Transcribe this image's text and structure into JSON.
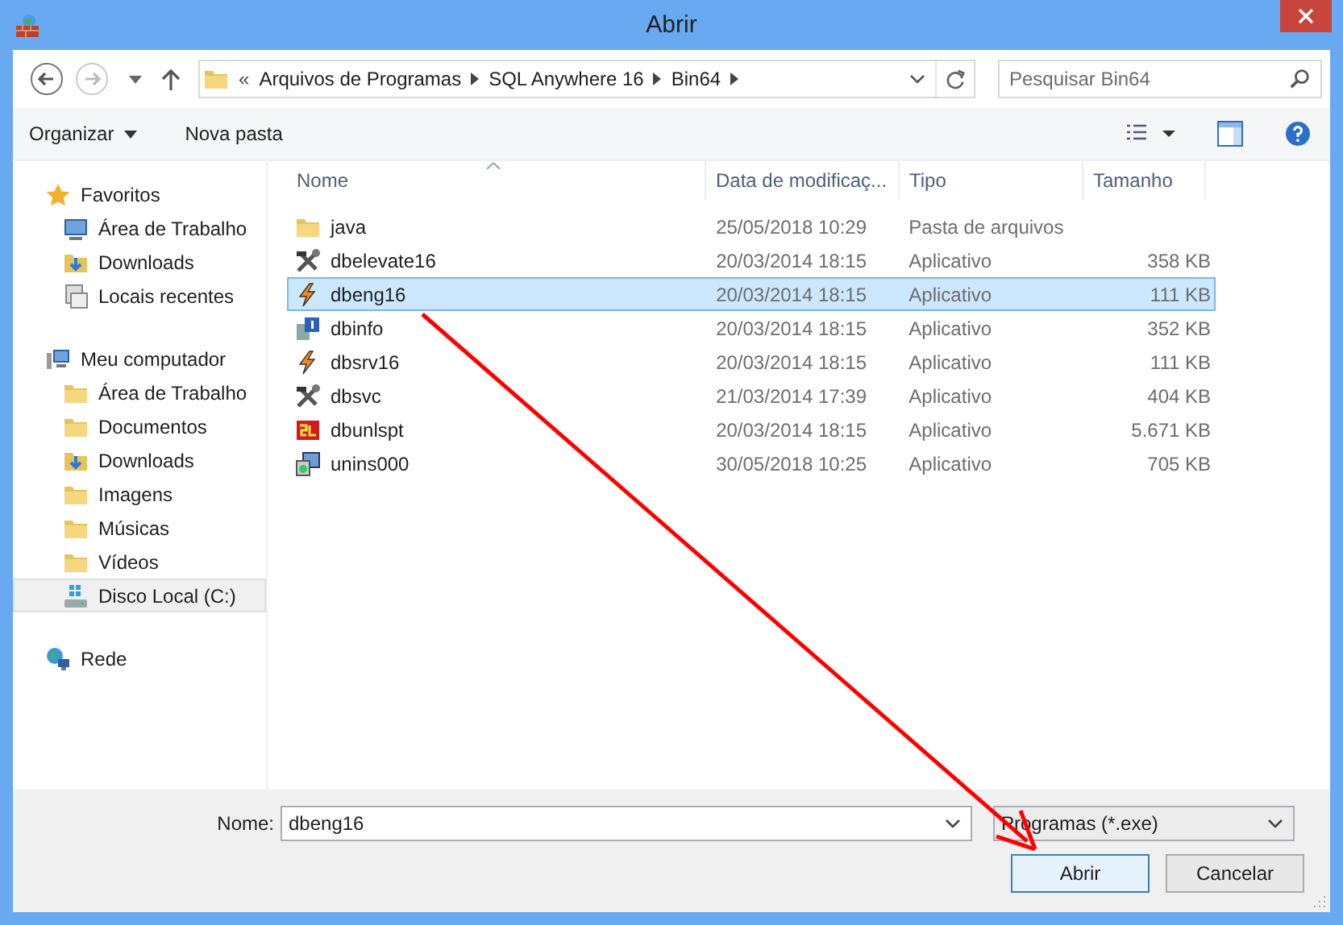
{
  "window": {
    "title": "Abrir"
  },
  "address": {
    "overflow": "«",
    "segments": [
      "Arquivos de Programas",
      "SQL Anywhere 16",
      "Bin64"
    ]
  },
  "search": {
    "placeholder": "Pesquisar Bin64"
  },
  "toolbar": {
    "organize": "Organizar",
    "new_folder": "Nova pasta"
  },
  "sidebar": [
    {
      "label": "Favoritos",
      "kind": "star",
      "selected": false,
      "children": [
        {
          "label": "Área de Trabalho",
          "kind": "desktop",
          "selected": false
        },
        {
          "label": "Downloads",
          "kind": "downloads",
          "selected": false
        },
        {
          "label": "Locais recentes",
          "kind": "recent",
          "selected": false
        }
      ]
    },
    {
      "label": "Meu computador",
      "kind": "computer",
      "selected": false,
      "children": [
        {
          "label": "Área de Trabalho",
          "kind": "folder",
          "selected": false
        },
        {
          "label": "Documentos",
          "kind": "folder",
          "selected": false
        },
        {
          "label": "Downloads",
          "kind": "downloads",
          "selected": false
        },
        {
          "label": "Imagens",
          "kind": "folder",
          "selected": false
        },
        {
          "label": "Músicas",
          "kind": "folder",
          "selected": false
        },
        {
          "label": "Vídeos",
          "kind": "folder",
          "selected": false
        },
        {
          "label": "Disco Local (C:)",
          "kind": "drive",
          "selected": true
        }
      ]
    },
    {
      "label": "Rede",
      "kind": "network",
      "selected": false
    }
  ],
  "columns": [
    {
      "label": "Nome",
      "sorted": true
    },
    {
      "label": "Data de modificaç...",
      "sorted": false
    },
    {
      "label": "Tipo",
      "sorted": false
    },
    {
      "label": "Tamanho",
      "sorted": false
    }
  ],
  "rows": [
    {
      "name": "java",
      "date": "25/05/2018 10:29",
      "type": "Pasta de arquivos",
      "kind": "folder",
      "selected": false
    },
    {
      "name": "dbelevate16",
      "date": "20/03/2014 18:15",
      "type": "Aplicativo",
      "size": "358 KB",
      "kind": "tools",
      "selected": false
    },
    {
      "name": "dbeng16",
      "date": "20/03/2014 18:15",
      "type": "Aplicativo",
      "size": "111 KB",
      "kind": "bolt",
      "selected": true
    },
    {
      "name": "dbinfo",
      "date": "20/03/2014 18:15",
      "type": "Aplicativo",
      "size": "352 KB",
      "kind": "info",
      "selected": false
    },
    {
      "name": "dbsrv16",
      "date": "20/03/2014 18:15",
      "type": "Aplicativo",
      "size": "111 KB",
      "kind": "bolt",
      "selected": false
    },
    {
      "name": "dbsvc",
      "date": "21/03/2014 17:39",
      "type": "Aplicativo",
      "size": "404 KB",
      "kind": "tools",
      "selected": false
    },
    {
      "name": "dbunlspt",
      "date": "20/03/2014 18:15",
      "type": "Aplicativo",
      "size": "5.671 KB",
      "kind": "sql",
      "selected": false
    },
    {
      "name": "unins000",
      "date": "30/05/2018 10:25",
      "type": "Aplicativo",
      "size": "705 KB",
      "kind": "installer",
      "selected": false
    }
  ],
  "filename": {
    "label": "Nome:",
    "value": "dbeng16"
  },
  "filter": {
    "value": "Programas (*.exe)"
  },
  "buttons": [
    {
      "label": "Abrir",
      "default": true
    },
    {
      "label": "Cancelar",
      "default": false
    }
  ]
}
